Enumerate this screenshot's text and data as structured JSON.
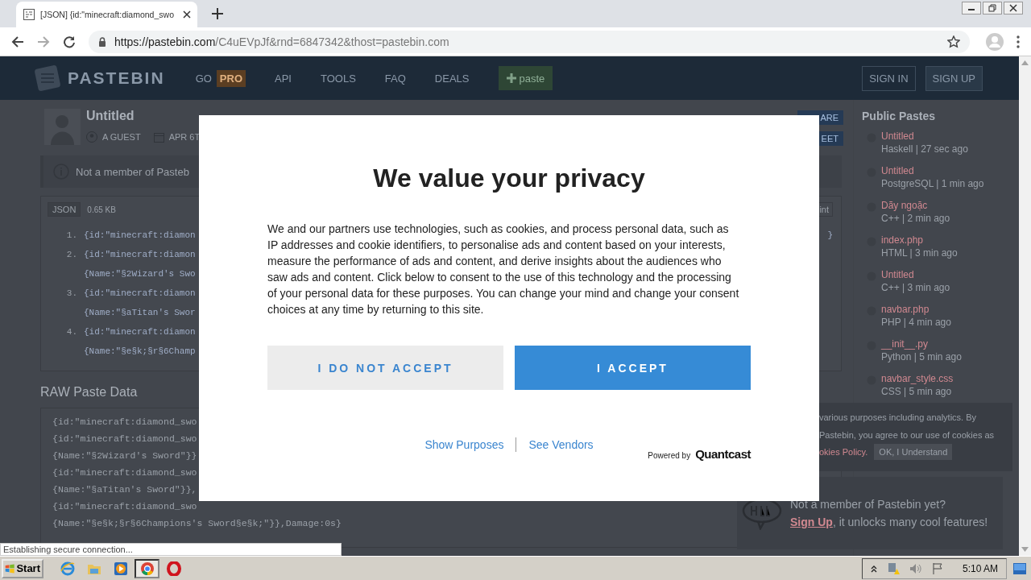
{
  "browser": {
    "tab_title": "[JSON] {id:\"minecraft:diamond_swo",
    "url_host": "https://pastebin.com",
    "url_path": "/C4uEVpJf&rnd=6847342&thost=pastebin.com"
  },
  "header": {
    "logo": "PASTEBIN",
    "nav": [
      {
        "label": "GO",
        "badge": "PRO"
      },
      {
        "label": "API"
      },
      {
        "label": "TOOLS"
      },
      {
        "label": "FAQ"
      },
      {
        "label": "DEALS"
      }
    ],
    "paste_button": "paste",
    "auth": [
      "SIGN IN",
      "SIGN UP"
    ]
  },
  "paste": {
    "title": "Untitled",
    "author": "A GUEST",
    "date": "APR 6T",
    "share_buttons": [
      "ARE",
      "EET"
    ]
  },
  "notice": "Not a member of Pasteb",
  "code": {
    "syntax": "JSON",
    "size": "0.65 KB",
    "side_button": "int",
    "side_text": "}",
    "lines": [
      {
        "number": "1.",
        "text": "{id:\"minecraft:diamon"
      },
      {
        "number": "2.",
        "text": "{id:\"minecraft:diamon"
      },
      {
        "text": "{Name:\"§2Wizard's Swo"
      },
      {
        "number": "3.",
        "text": "{id:\"minecraft:diamon"
      },
      {
        "text": "{Name:\"§aTitan's Swor"
      },
      {
        "number": "4.",
        "text": "{id:\"minecraft:diamon"
      },
      {
        "text": "{Name:\"§e§k;§r§6Champ"
      }
    ]
  },
  "raw": {
    "heading": "RAW Paste Data",
    "lines": [
      "{id:\"minecraft:diamond_swo",
      "{id:\"minecraft:diamond_swo",
      "{Name:\"§2Wizard's Sword\"}}",
      "{id:\"minecraft:diamond_swo",
      "{Name:\"§aTitan's Sword\"}},",
      "{id:\"minecraft:diamond_swo",
      "{Name:\"§e§k;§r§6Champions's Sword§e§k;\"}},Damage:0s}"
    ]
  },
  "sidebar": {
    "title": "Public Pastes",
    "items": [
      {
        "title": "Untitled",
        "meta": "Haskell | 27 sec ago"
      },
      {
        "title": "Untitled",
        "meta": "PostgreSQL | 1 min ago"
      },
      {
        "title": "Dãy ngoặc",
        "meta": "C++ | 2 min ago"
      },
      {
        "title": "index.php",
        "meta": "HTML | 3 min ago"
      },
      {
        "title": "Untitled",
        "meta": "C++ | 3 min ago"
      },
      {
        "title": "navbar.php",
        "meta": "PHP | 4 min ago"
      },
      {
        "title": "__init__.py",
        "meta": "Python | 5 min ago"
      },
      {
        "title": "navbar_style.css",
        "meta": "CSS | 5 min ago"
      }
    ]
  },
  "cookie_notice": {
    "lines": [
      "various purposes including analytics. By",
      "Pastebin, you agree to our use of cookies as"
    ],
    "link": "okies Policy.",
    "button": "OK, I Understand"
  },
  "signup_box": {
    "text": "Not a member of Pastebin yet?",
    "link": "Sign Up",
    "rest": ", it unlocks many cool features!"
  },
  "modal": {
    "title": "We value your privacy",
    "body": "We and our partners use technologies, such as cookies, and process personal data, such as IP addresses and cookie identifiers, to personalise ads and content based on your interests, measure the performance of ads and content, and derive insights about the audiences who saw ads and content. Click below to consent to the use of this technology and the processing of your personal data for these purposes. You can change your mind and change your consent choices at any time by returning to this site.",
    "buttons": [
      {
        "label": "I DO NOT ACCEPT",
        "kind": "decline"
      },
      {
        "label": "I ACCEPT",
        "kind": "accept"
      }
    ],
    "links": [
      "Show Purposes",
      "See Vendors"
    ],
    "powered_by": "Powered by",
    "brand": "Quantcast"
  },
  "status_bar": "Establishing secure connection...",
  "taskbar": {
    "start": "Start",
    "apps": [
      {
        "kind": "ie",
        "selected": false
      },
      {
        "kind": "explorer",
        "selected": false
      },
      {
        "kind": "media",
        "selected": false
      },
      {
        "kind": "chrome",
        "selected": true
      },
      {
        "kind": "opera",
        "selected": false
      }
    ],
    "clock": "5:10 AM"
  }
}
